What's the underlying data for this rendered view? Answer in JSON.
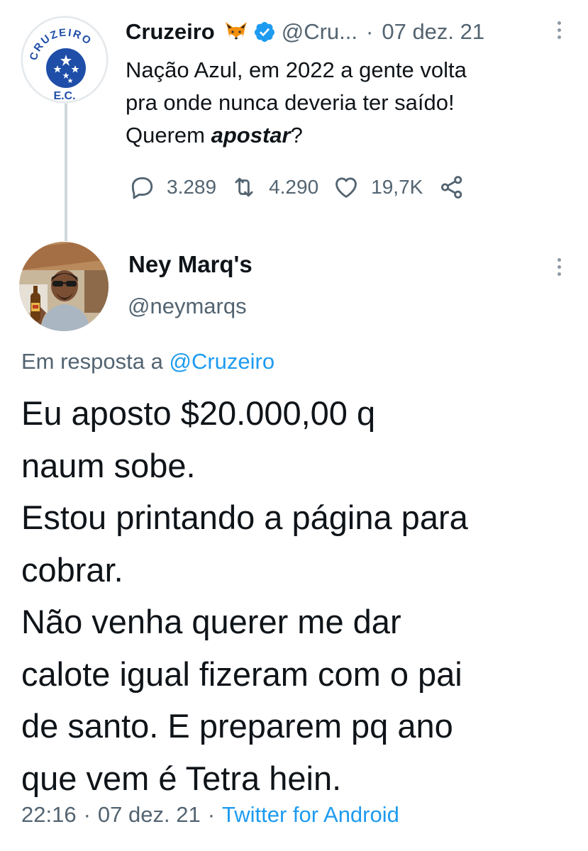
{
  "parent_tweet": {
    "avatar": {
      "arc_text": "CRUZEIRO",
      "bottom_text": "E.C."
    },
    "display_name": "Cruzeiro",
    "name_emoji": "fox-emoji",
    "verified_icon": "verified-badge-icon",
    "handle": "@Cru...",
    "separator": "·",
    "date": "07 dez. 21",
    "text_lines": [
      "Nação Azul, em 2022 a gente volta",
      "pra onde nunca deveria ter saído!"
    ],
    "text_last_before": "Querem ",
    "text_last_emphasis": "apostar",
    "text_last_after": "?",
    "replies": "3.289",
    "retweets": "4.290",
    "likes": "19,7K"
  },
  "tweet": {
    "display_name": "Ney Marq's",
    "handle": "@neymarqs",
    "reply_prefix": "Em resposta a",
    "reply_target": "@Cruzeiro",
    "text_lines": [
      "Eu aposto $20.000,00 q",
      "naum sobe.",
      "Estou printando a página para",
      "cobrar.",
      "Não venha querer me dar",
      "calote igual fizeram com o pai",
      "de santo. E preparem pq ano",
      "que vem é Tetra hein."
    ],
    "time": "22:16",
    "separator": "·",
    "date": "07 dez. 21",
    "source": "Twitter for Android"
  },
  "colors": {
    "text": "#0f1419",
    "muted": "#536471",
    "link": "#1d9bf0",
    "cruzeiro_blue": "#1f4ea8",
    "thread_line": "#cfd9de"
  }
}
